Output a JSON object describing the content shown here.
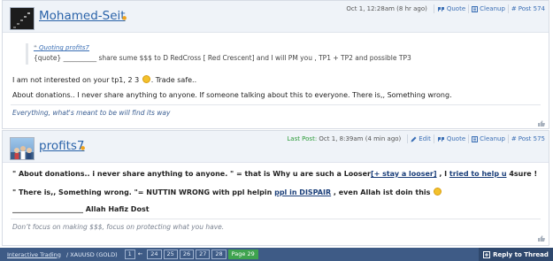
{
  "post1": {
    "username": "Mohamed-Seit",
    "time": "Oct 1, 12:28am (8 hr ago)",
    "actions": {
      "quote": "Quote",
      "cleanup": "Cleanup",
      "post_no": "Post 574"
    },
    "quote": {
      "header": "Quoting profits7",
      "text": "{quote} __________ share sume $$$ to D RedCross [ Red Crescent] and I will PM you , TP1 + TP2 and possible TP3"
    },
    "line1": "I am not interested on your tp1, 2 3",
    "line1_end": ". Trade safe..",
    "line2": "About donations.. I never share anything to anyone. If someone talking about this to everyone. There is,, Something wrong.",
    "signature": "Everything, what's meant to be will find its way"
  },
  "post2": {
    "username": "profits7",
    "last_post_label": "Last Post:",
    "time": "Oct 1, 8:39am (4 min ago)",
    "actions": {
      "edit": "Edit",
      "quote": "Quote",
      "cleanup": "Cleanup",
      "post_no": "Post 575"
    },
    "line1_a": "\" About donations.. i never share anything to anyone. \" = that is Why u are such a Looser",
    "line1_link": "[+ stay a looser]",
    "line1_b": " , I ",
    "line1_link2": "tried to help u",
    "line1_c": " 4sure !",
    "line2_a": "\" There is,, Something wrong. \"= NUTTIN WRONG with ppl helpin ",
    "line2_link": "ppl in DISPAIR",
    "line2_b": " , even Allah ist doin this",
    "line3": "____________________ Allah Hafiz Dost",
    "signature": "Don’t focus on making $$$, focus on protecting what you have."
  },
  "footer": {
    "crumb1": "Interactive Trading",
    "crumb2": "/ XAUUSD (GOLD)",
    "pages": [
      "1",
      "24",
      "25",
      "26",
      "27",
      "28"
    ],
    "arrow": "←",
    "current_page": "Page 29",
    "reply": "Reply to Thread"
  },
  "colors": {
    "accent": "#2a63a9",
    "footer_bg": "#3e5b86",
    "current_page": "#3fa34f"
  }
}
